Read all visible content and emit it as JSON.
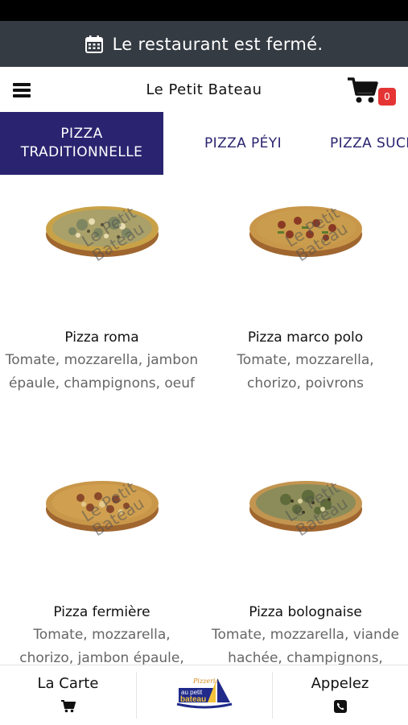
{
  "banner": {
    "text": "Le restaurant est fermé.",
    "icon": "calendar-icon"
  },
  "header": {
    "title": "Le Petit Bateau",
    "cart_count": "0"
  },
  "tabs": [
    {
      "label": "PIZZA TRADITIONNELLE",
      "active": true
    },
    {
      "label": "PIZZA PÉYI",
      "active": false
    },
    {
      "label": "PIZZA SUCRÉE",
      "active": false
    }
  ],
  "watermark": "Le Petit Bateau",
  "pizzas": [
    {
      "name": "Pizza roma",
      "desc": "Tomate, mozzarella, jambon épaule, champignons, oeuf"
    },
    {
      "name": "Pizza marco polo",
      "desc": "Tomate, mozzarella, chorizo, poivrons"
    },
    {
      "name": "Pizza fermière",
      "desc": "Tomate, mozzarella, chorizo, jambon épaule,"
    },
    {
      "name": "Pizza bolognaise",
      "desc": "Tomate, mozzarella, viande hachée, champignons,"
    }
  ],
  "bottom_nav": {
    "carte_label": "La Carte",
    "logo_text": "Pizzeria au petit bateau",
    "call_label": "Appelez"
  },
  "colors": {
    "brand": "#2a2470",
    "banner": "#353b43",
    "badge": "#e53434"
  }
}
